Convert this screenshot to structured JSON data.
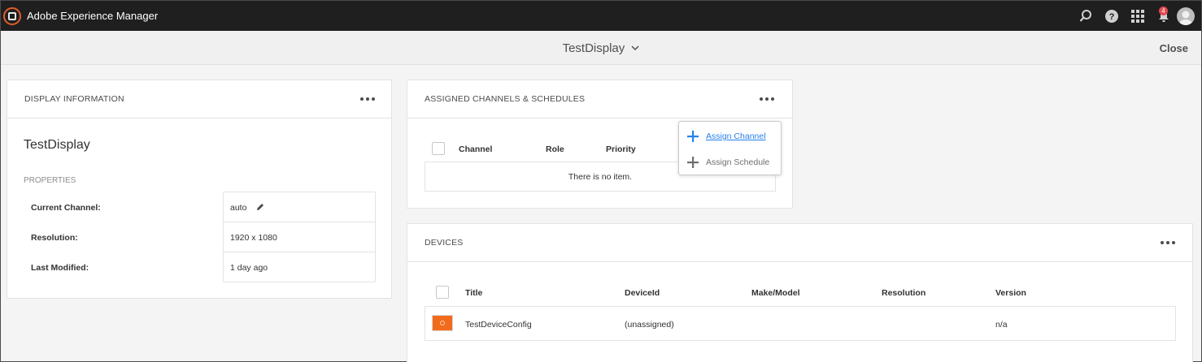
{
  "app": {
    "title": "Adobe Experience Manager",
    "notification_count": "4"
  },
  "page": {
    "title": "TestDisplay",
    "close_label": "Close"
  },
  "display_info": {
    "title": "DISPLAY INFORMATION",
    "name": "TestDisplay",
    "properties_label": "PROPERTIES",
    "rows": [
      {
        "label": "Current Channel:",
        "value": "auto"
      },
      {
        "label": "Resolution:",
        "value": "1920 x 1080"
      },
      {
        "label": "Last Modified:",
        "value": "1 day ago"
      }
    ]
  },
  "channels": {
    "title": "ASSIGNED CHANNELS & SCHEDULES",
    "columns": [
      "Channel",
      "Role",
      "Priority"
    ],
    "empty_text": "There is no item.",
    "menu": {
      "assign_channel": "Assign Channel",
      "assign_schedule": "Assign Schedule"
    }
  },
  "devices": {
    "title": "DEVICES",
    "columns": [
      "Title",
      "DeviceId",
      "Make/Model",
      "Resolution",
      "Version"
    ],
    "rows": [
      {
        "title": "TestDeviceConfig",
        "device_id": "(unassigned)",
        "make_model": "",
        "resolution": "",
        "version": "n/a"
      }
    ]
  },
  "colors": {
    "accent": "#2680eb",
    "device_thumb": "#f26b1d",
    "topbar": "#1f1f1f"
  }
}
